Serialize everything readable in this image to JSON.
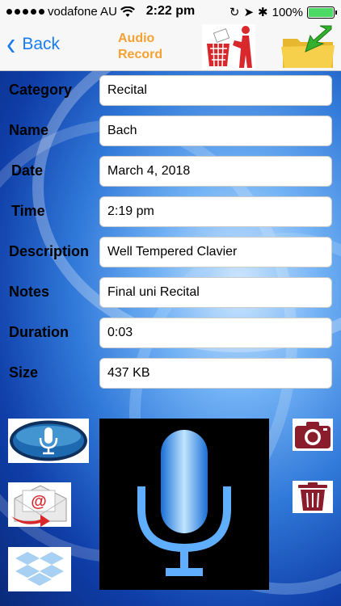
{
  "status": {
    "carrier": "vodafone AU",
    "time": "2:22 pm",
    "battery_percent": "100%"
  },
  "nav": {
    "back_label": "Back",
    "title_line1": "Audio",
    "title_line2": "Record"
  },
  "fields": [
    {
      "label": "Category",
      "value": "Recital"
    },
    {
      "label": "Name",
      "value": "Bach"
    },
    {
      "label": "Date",
      "value": "March 4, 2018"
    },
    {
      "label": "Time",
      "value": "2:19 pm"
    },
    {
      "label": "Description",
      "value": "Well Tempered Clavier"
    },
    {
      "label": "Notes",
      "value": "Final uni Recital"
    },
    {
      "label": "Duration",
      "value": "0:03"
    },
    {
      "label": "Size",
      "value": "437 KB"
    }
  ],
  "email_glyph": "@",
  "colors": {
    "accent_blue": "#1a7cf4",
    "title_orange": "#f5a133",
    "trash_red": "#d8282c",
    "folder_yellow": "#f6d04a",
    "maroon": "#8b1c2c"
  },
  "icons": {
    "trash_top": "trash-icon",
    "folder_top": "folder-save-icon",
    "mic_button": "microphone-button-icon",
    "email": "email-icon",
    "dropbox": "dropbox-icon",
    "camera": "camera-icon",
    "trash_side": "trash-icon",
    "mic_large": "microphone-icon"
  }
}
